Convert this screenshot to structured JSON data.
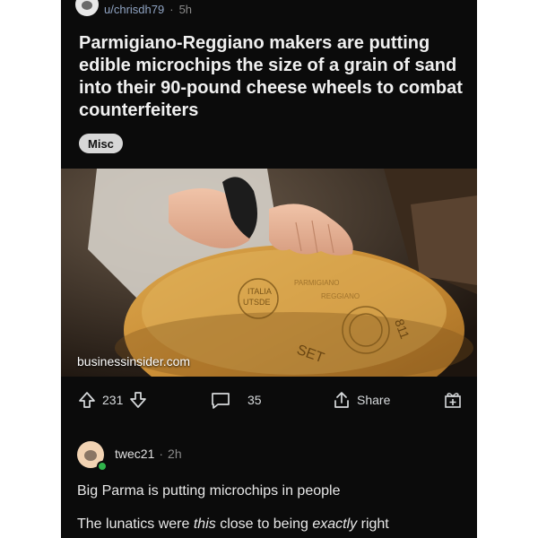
{
  "post": {
    "username": "u/chrisdh79",
    "separator": "·",
    "age": "5h",
    "title": "Parmigiano-Reggiano makers are putting edible microchips the size of a grain of sand into their 90-pound cheese wheels to combat counterfeiters",
    "flair": "Misc",
    "link_domain": "businessinsider.com",
    "image": {
      "cheese_stamps": [
        "ITALIA",
        "UTSDE",
        "PARMIGIANO",
        "REGGIANO",
        "811",
        "SET"
      ]
    }
  },
  "actions": {
    "upvotes": "231",
    "comments": "35",
    "share_label": "Share"
  },
  "comment": {
    "username": "twec21",
    "separator": "·",
    "age": "2h",
    "line1": "Big Parma is putting microchips in people",
    "line2_a": "The lunatics were ",
    "line2_b": "this",
    "line2_c": " close to being ",
    "line2_d": "exactly",
    "line2_e": " right"
  },
  "colors": {
    "background": "#0b0b0b",
    "username": "#8fa3c2",
    "flair_bg": "#d7d7d7",
    "online": "#2fb34a"
  }
}
